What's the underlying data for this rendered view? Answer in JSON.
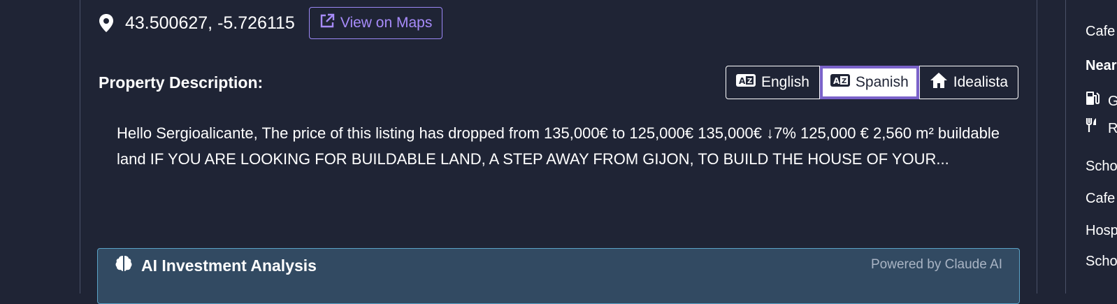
{
  "location": {
    "coordinates": "43.500627, -5.726115",
    "maps_button_label": "View on Maps"
  },
  "description": {
    "title": "Property Description:",
    "languages": [
      "English",
      "Spanish",
      "Idealista"
    ],
    "active_language": "Spanish",
    "text": "Hello Sergioalicante, The price of this listing has dropped from 135,000€ to 125,000€ 135,000€ ↓7% 125,000 € 2,560 m² buildable land IF YOU ARE LOOKING FOR BUILDABLE LAND, A STEP AWAY FROM GIJON, TO BUILD THE HOUSE OF YOUR..."
  },
  "ai_analysis": {
    "title": "AI Investment Analysis",
    "powered_by": "Powered by Claude AI"
  },
  "sidebar": {
    "items": [
      "Cafe",
      "Near",
      "G",
      "Re",
      "Scho",
      "Cafe",
      "Hosp",
      "Scho"
    ]
  },
  "colors": {
    "background": "#1f2435",
    "accent_purple": "#a78bfa",
    "active_border": "#7a62c9",
    "ai_panel_bg": "#324a62"
  }
}
